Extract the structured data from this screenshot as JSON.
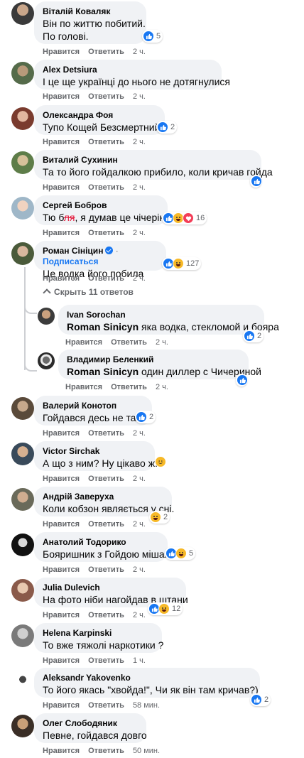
{
  "labels": {
    "like": "Нравится",
    "reply": "Ответить",
    "follow": "Подписаться",
    "hide_replies": "Скрыть 11 ответов"
  },
  "comments": [
    {
      "name": "Віталій Коваляк",
      "lines": [
        "Він по життю побитий.",
        "По голові."
      ],
      "time": "2 ч.",
      "reactions": "5"
    },
    {
      "name": "Alex Detsiura",
      "lines": [
        "І це ще українці до нього не дотягнулися"
      ],
      "time": "2 ч.",
      "reactions": ""
    },
    {
      "name": "Олександра Фоя",
      "lines": [
        "Тупо Кощей Безсмертний))"
      ],
      "time": "2 ч.",
      "reactions": "2"
    },
    {
      "name": "Виталий Сухинин",
      "lines": [
        "Та то його гойдалкою прибило, коли кричав гойда"
      ],
      "time": "2 ч.",
      "reactions": ""
    },
    {
      "name": "Сергей Бобров",
      "lines_a": "Тю б",
      "censored": "ля",
      "lines_b": ", я думав це чічеріна",
      "time": "2 ч.",
      "reactions": "16"
    },
    {
      "name": "Роман Сініцин",
      "lines": [
        "Це водка його побила"
      ],
      "time": "2 ч.",
      "reactions": "127"
    }
  ],
  "replies": [
    {
      "name": "Ivan Sorochan",
      "mention": "Roman Sinicyn",
      "text": "яка водка, стекломой и бояра",
      "time": "2 ч.",
      "reactions": "2"
    },
    {
      "name": "Владимир Беленкий",
      "mention": "Roman Sinicyn",
      "text": "один диллер с Чичериной",
      "time": "2 ч.",
      "reactions": ""
    }
  ],
  "comments2": [
    {
      "name": "Валерий Конотоп",
      "text": "Гойдався десь не там",
      "time": "2 ч.",
      "reactions": "2"
    },
    {
      "name": "Victor Sirchak",
      "text": "А що з ним? Ну цікаво ж...",
      "time": "2 ч.",
      "reactions": ""
    },
    {
      "name": "Андрій Заверуха",
      "text": "Коли кобзон являється у сні.",
      "time": "2 ч.",
      "reactions": "2"
    },
    {
      "name": "Анатолий Тодорико",
      "text": "Бояришник з Гойдою мішав",
      "time": "2 ч.",
      "reactions": "5"
    },
    {
      "name": "Julia Dulevich",
      "text": "На фото ніби нагойдав в штани",
      "time": "2 ч.",
      "reactions": "12"
    },
    {
      "name": "Helena Karpinski",
      "text": "То вже тяжолі наркотики ?",
      "time": "1 ч.",
      "reactions": ""
    },
    {
      "name": "Aleksandr Yakovenko",
      "text": "То його якась \"хвойда!\", Чи як він там кричав?)",
      "time": "58 мин.",
      "reactions": "2"
    },
    {
      "name": "Олег Слободяник",
      "text": "Певне, гойдався довго",
      "time": "50 мин.",
      "reactions": ""
    }
  ],
  "colors": {
    "link": "#1877f2",
    "bubble": "#f0f2f5",
    "meta": "#65676b"
  }
}
